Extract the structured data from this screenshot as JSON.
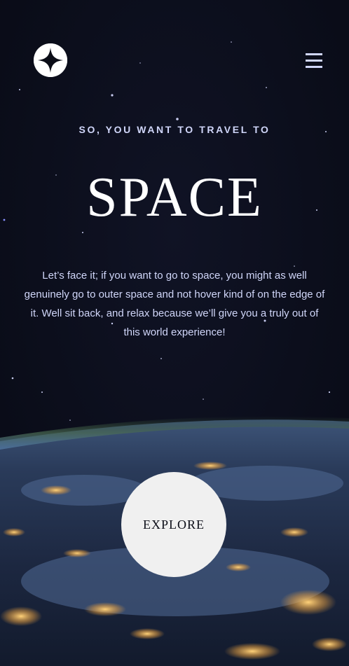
{
  "header": {
    "logo_icon": "four-point-star-icon",
    "menu_icon": "hamburger-menu-icon"
  },
  "hero": {
    "eyebrow": "SO, YOU WANT TO TRAVEL TO",
    "title": "SPACE",
    "description": "Let’s face it; if you want to go to space, you might as well genuinely go to outer space and not hover kind of on the edge of it. Well sit back, and relax because we’ll give you a truly out of this world experience!",
    "explore_label": "EXPLORE"
  },
  "colors": {
    "background": "#0b0d1a",
    "text_light": "#d0d6f9",
    "white": "#ffffff",
    "button_bg": "#f0f0f0",
    "button_text": "#0b0d17"
  }
}
